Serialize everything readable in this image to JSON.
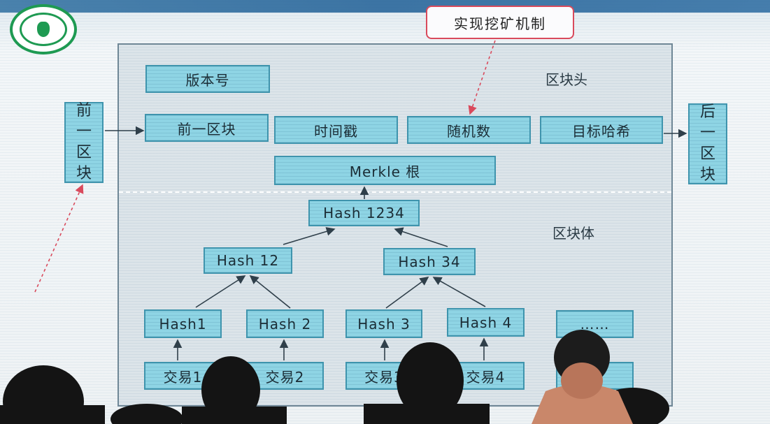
{
  "callout": {
    "text": "实现挖矿机制"
  },
  "header_label": "区块头",
  "body_label": "区块体",
  "prev_block": "前一区块",
  "next_block": "后一区块",
  "header_fields": {
    "version": "版本号",
    "prev_block": "前一区块",
    "timestamp": "时间戳",
    "nonce": "随机数",
    "target_hash": "目标哈希"
  },
  "merkle_root": "Merkle 根",
  "hash_nodes": {
    "h1234": "Hash 1234",
    "h12": "Hash 12",
    "h34": "Hash 34",
    "h1": "Hash1",
    "h2": "Hash 2",
    "h3": "Hash 3",
    "h4": "Hash 4",
    "more": "……"
  },
  "transactions": [
    "交易1",
    "交易2",
    "交易3",
    "交易4"
  ],
  "colors": {
    "box_fill": "#8ed4e4",
    "box_border": "#3f94ad",
    "panel_fill": "#dce4e9",
    "callout_border": "#d94a5c",
    "logo_green": "#1e9a52"
  }
}
